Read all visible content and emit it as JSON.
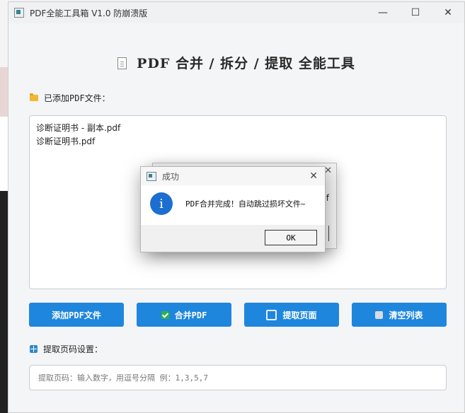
{
  "window": {
    "title": "PDF全能工具箱 V1.0 防崩溃版",
    "minimize": "—",
    "maximize": "☐",
    "close": "✕"
  },
  "heading": "PDF 合并 / 拆分 / 提取 全能工具",
  "files_section": {
    "label": "已添加PDF文件：",
    "icon": "folder-icon",
    "items": [
      "诊断证明书 - 副本.pdf",
      "诊断证明书.pdf"
    ]
  },
  "buttons": {
    "add": "添加PDF文件",
    "merge": "合并PDF",
    "extract": "提取页面",
    "clear": "清空列表"
  },
  "pages_section": {
    "label": "提取页码设置：",
    "placeholder": "提取页码：输入数字，用逗号分隔 例：1,3,5,7"
  },
  "dialog": {
    "title": "成功",
    "message": "PDF合并完成！自动跳过损坏文件~",
    "ok": "OK",
    "close": "✕",
    "info_glyph": "i"
  },
  "ghost_dialog": {
    "close": "✕",
    "partial_text": "f"
  },
  "colors": {
    "accent": "#1f86dd",
    "info": "#1c6fd0"
  }
}
